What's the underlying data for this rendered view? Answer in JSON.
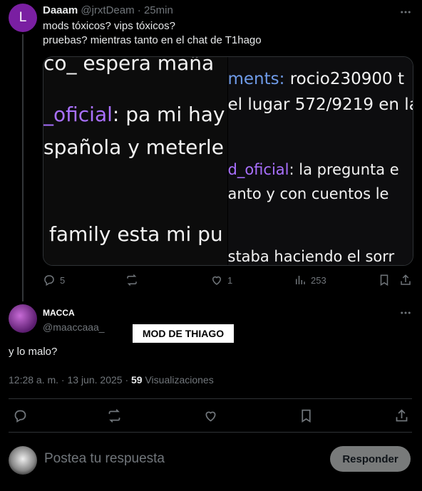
{
  "parent_tweet": {
    "avatar_letter": "L",
    "name": "Daaam",
    "handle": "@jrxtDeam",
    "sep": "·",
    "time": "25min",
    "text_line1": "mods tóxicos? vips tóxicos?",
    "text_line2": "pruebas? mientras tanto en el chat de T1hago",
    "media_left": {
      "line1": "co_  espera maña",
      "line2_user": "_oficial",
      "line2_rest": ": pa mi hay",
      "line3": "spañola y meterle",
      "line4": "family esta mi pu"
    },
    "media_right": {
      "line1_user": "ments:",
      "line1_rest": "  rocio230900 t",
      "line2": "el lugar 572/9219 en la",
      "line3_user": "d_oficial",
      "line3_rest": ": la pregunta e",
      "line4": "anto y con cuentos le",
      "line5": "staba haciendo el sorr"
    },
    "stats": {
      "replies": "5",
      "likes": "1",
      "views": "253"
    }
  },
  "reply": {
    "name": "MACCA",
    "handle": "@maaccaaa_",
    "label": "MOD DE THIAGO",
    "text": "y lo malo?",
    "meta_time": "12:28 a. m. · 13 jun. 2025 · ",
    "meta_views": "59",
    "meta_views_label": " Visualizaciones"
  },
  "compose": {
    "placeholder": "Postea tu respuesta",
    "button": "Responder"
  },
  "colors": {
    "background": "#000000",
    "twitch_purple": "#a970ff",
    "muted": "#71767b"
  }
}
